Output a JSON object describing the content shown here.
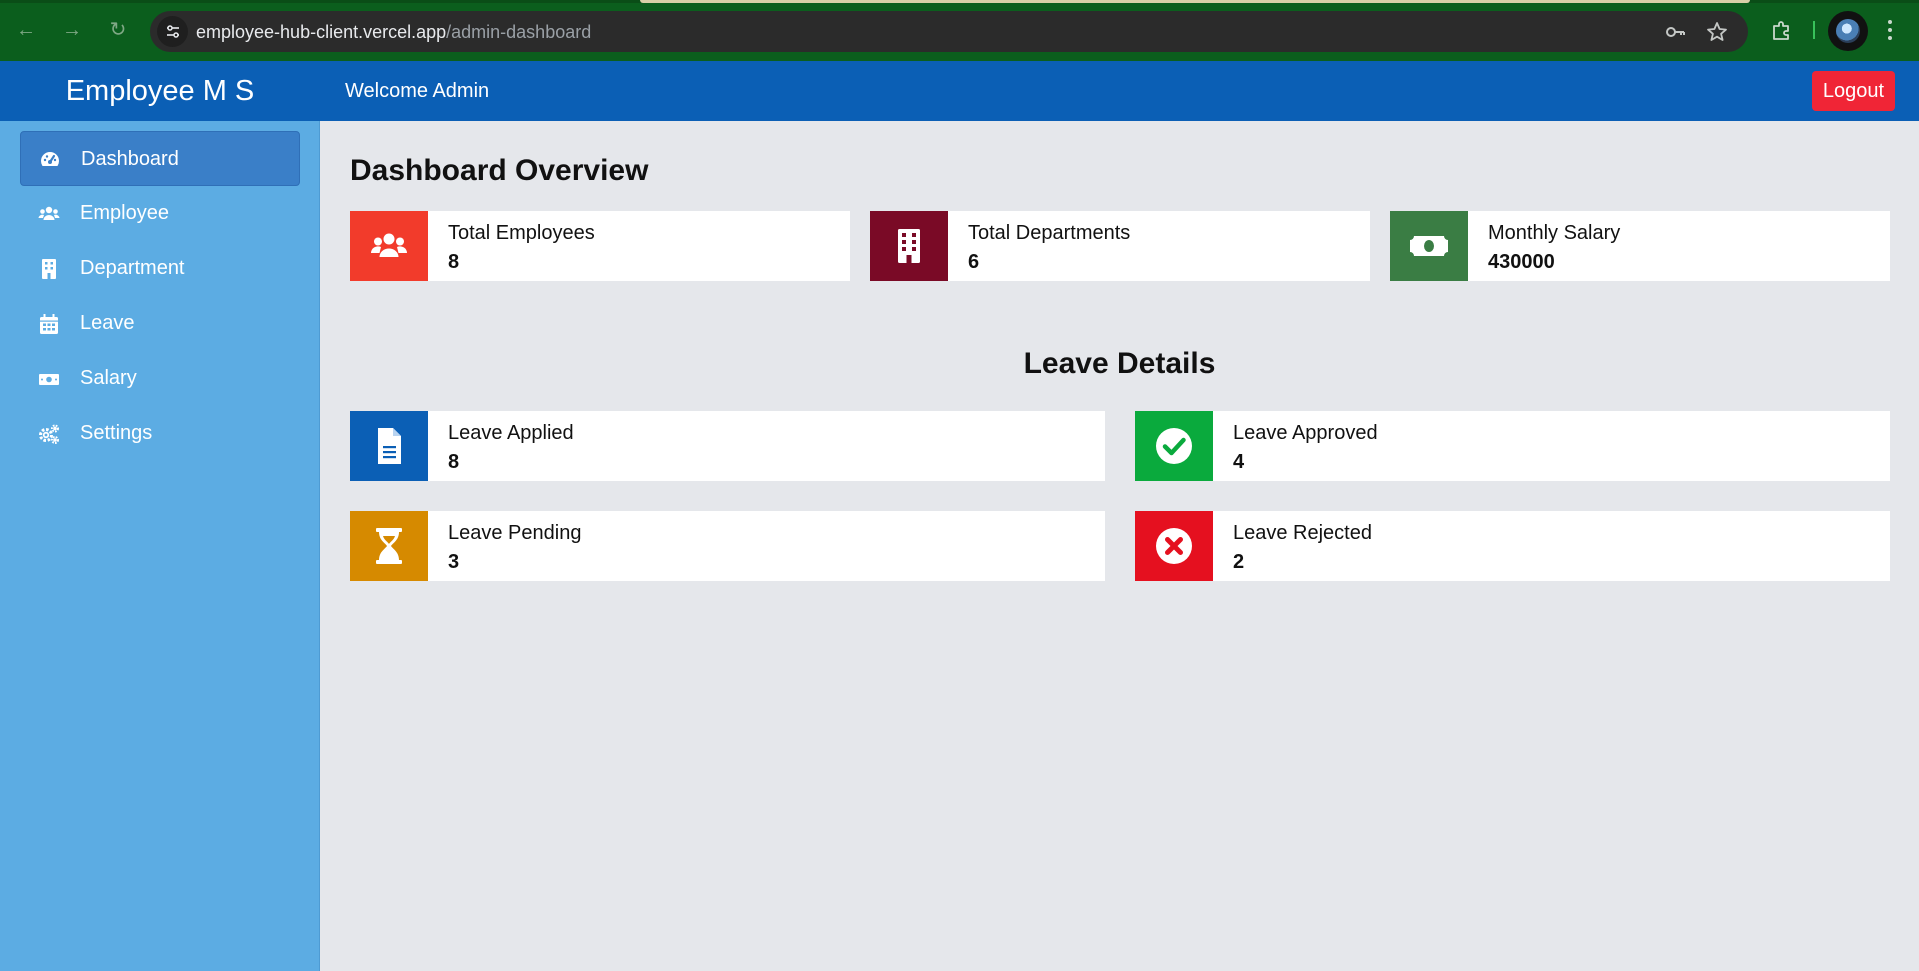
{
  "browser": {
    "url_host": "employee-hub-client.vercel.app",
    "url_path": "/admin-dashboard"
  },
  "header": {
    "brand": "Employee M S",
    "welcome": "Welcome Admin",
    "logout_label": "Logout"
  },
  "sidebar": {
    "items": [
      {
        "label": "Dashboard",
        "icon": "gauge-icon",
        "active": true
      },
      {
        "label": "Employee",
        "icon": "users-icon",
        "active": false
      },
      {
        "label": "Department",
        "icon": "building-icon",
        "active": false
      },
      {
        "label": "Leave",
        "icon": "calendar-icon",
        "active": false
      },
      {
        "label": "Salary",
        "icon": "money-bill-icon",
        "active": false
      },
      {
        "label": "Settings",
        "icon": "cogs-icon",
        "active": false
      }
    ]
  },
  "overview": {
    "title": "Dashboard Overview",
    "cards": [
      {
        "label": "Total Employees",
        "value": "8",
        "icon": "users-icon",
        "color": "#f23b2b"
      },
      {
        "label": "Total Departments",
        "value": "6",
        "icon": "building-icon",
        "color": "#7a0a26"
      },
      {
        "label": "Monthly Salary",
        "value": "430000",
        "icon": "money-bill-icon",
        "color": "#3a7d44"
      }
    ]
  },
  "leave": {
    "title": "Leave Details",
    "cards": [
      {
        "label": "Leave Applied",
        "value": "8",
        "icon": "file-icon",
        "color": "#0b5fb5"
      },
      {
        "label": "Leave Approved",
        "value": "4",
        "icon": "check-circle-icon",
        "color": "#0aaa3d"
      },
      {
        "label": "Leave Pending",
        "value": "3",
        "icon": "hourglass-icon",
        "color": "#d68a00"
      },
      {
        "label": "Leave Rejected",
        "value": "2",
        "icon": "times-circle-icon",
        "color": "#e5101f"
      }
    ]
  },
  "colors": {
    "header": "#0b5fb5",
    "sidebar": "#5cace3",
    "sidebar_active": "#3a7fc8",
    "logout": "#f02536",
    "background": "#e5e7eb"
  }
}
